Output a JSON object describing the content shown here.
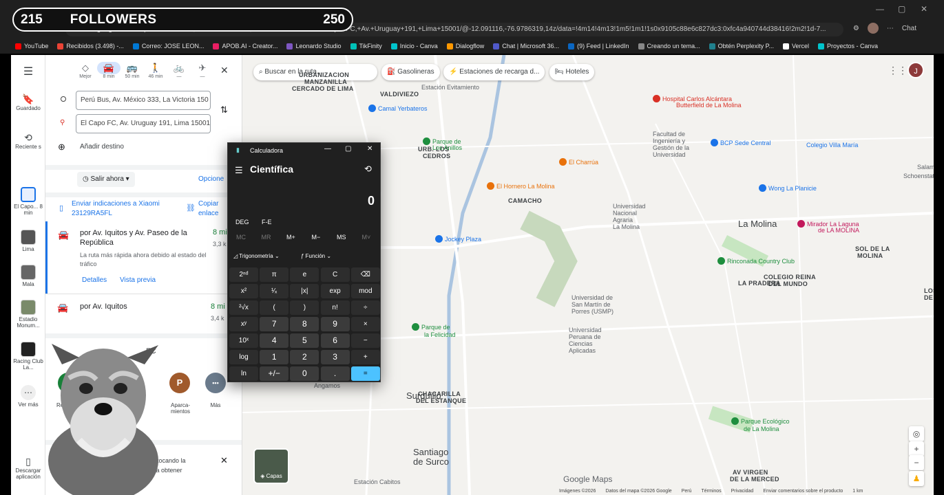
{
  "overlay": {
    "followers_count": "215",
    "followers_label": "FOLLOWERS",
    "followers_goal": "250"
  },
  "browser": {
    "url": "...//www.google.com/maps/dir/Perú+Bus,+Av.+México+333,+La+Victoria+15033/El+Capo+FC,+Av.+Uruguay+191,+Lima+15001/@-12.091116,-76.9786319,14z/data=!4m14!4m13!1m5!1m1!1s0x9105c88e6c827dc3:0xfc4a940744d38416!2m2!1d-7...",
    "chat_label": "Chat",
    "bookmarks": [
      {
        "label": "YouTube",
        "color": "#ff0000"
      },
      {
        "label": "Recibidos (3.498) -...",
        "color": "#ea4335"
      },
      {
        "label": "Correo: JOSE LEON...",
        "color": "#0078d4"
      },
      {
        "label": "APOB.AI - Creator...",
        "color": "#e91e63"
      },
      {
        "label": "Leonardo Studio",
        "color": "#7e57c2"
      },
      {
        "label": "TikFinity",
        "color": "#00c2b8"
      },
      {
        "label": "Inicio - Canva",
        "color": "#00c4cc"
      },
      {
        "label": "Dialogflow",
        "color": "#ff9800"
      },
      {
        "label": "Chat | Microsoft 36...",
        "color": "#5059c9"
      },
      {
        "label": "(9) Feed | LinkedIn",
        "color": "#0a66c2"
      },
      {
        "label": "Creando un tema...",
        "color": "#888888"
      },
      {
        "label": "Obtén Perplexity P...",
        "color": "#20808d"
      },
      {
        "label": "Vercel",
        "color": "#ffffff"
      },
      {
        "label": "Proyectos - Canva",
        "color": "#00c4cc"
      }
    ]
  },
  "rail": {
    "saved": "Guardado",
    "recent": "Reciente s",
    "items": [
      {
        "label": "El Capo... 8 min"
      },
      {
        "label": "Lima"
      },
      {
        "label": "Mala"
      },
      {
        "label": "Estadio Monum..."
      },
      {
        "label": "Racing Club La..."
      }
    ],
    "more": "Ver más",
    "download": "Descargar aplicación"
  },
  "directions": {
    "modes": [
      {
        "icon": "◇",
        "label": "Mejor"
      },
      {
        "icon": "🚘",
        "label": "8 min"
      },
      {
        "icon": "🚌",
        "label": "50 min"
      },
      {
        "icon": "🚶",
        "label": "46 min"
      },
      {
        "icon": "🚲",
        "label": "—"
      },
      {
        "icon": "✈",
        "label": "—"
      }
    ],
    "origin": "Perú Bus, Av. México 333, La Victoria 150",
    "destination": "El Capo FC, Av. Uruguay 191, Lima 15001",
    "add_destination": "Añadir destino",
    "depart": "Salir ahora",
    "options": "Opcione",
    "send_to_phone": "Enviar indicaciones a Xiaomi 23129RA5FL",
    "copy_link": "Copiar enlace",
    "routes": [
      {
        "title": "por Av. Iquitos y Av. Paseo de la República",
        "time": "8 mi",
        "distance": "3,3 k",
        "note": "La ruta más rápida ahora debido al estado del tráfico",
        "details": "Detalles",
        "preview": "Vista previa"
      },
      {
        "title": "por Av. Iquitos",
        "time": "8 mi",
        "distance": "3,4 k"
      }
    ],
    "bottom_label": "FC",
    "actions": [
      {
        "letter": "P",
        "label": "Aparca-mientos"
      },
      {
        "letter": "•••",
        "label": "Más"
      }
    ],
    "partial_action": "Rest",
    "phone_tip": "rayecto tocando la ono para obtener"
  },
  "map": {
    "search_placeholder": "Buscar en la ruta...",
    "chips": [
      "Gasolineras",
      "Estaciones de recarga d...",
      "Hoteles"
    ],
    "layers": "Capas",
    "brand": "Google Maps",
    "labels": [
      {
        "text": "URBANIZACION",
        "cls": "b"
      },
      {
        "text": "MANZANILLA",
        "cls": "b"
      },
      {
        "text": "CERCADO DE LIMA",
        "cls": "b"
      },
      {
        "text": "VALDIVIEZO",
        "cls": "b"
      },
      {
        "text": "Estación Evitamiento",
        "cls": ""
      },
      {
        "text": "URB. LOS",
        "cls": "b"
      },
      {
        "text": "CEDROS",
        "cls": "b"
      },
      {
        "text": "CAMACHO",
        "cls": "b"
      },
      {
        "text": "La Molina",
        "cls": "big"
      },
      {
        "text": "LA PRADERA",
        "cls": "b"
      },
      {
        "text": "COLEGIO REINA",
        "cls": "b"
      },
      {
        "text": "DEL MUNDO",
        "cls": "b"
      },
      {
        "text": "SOL DE LA",
        "cls": "b"
      },
      {
        "text": "MOLINA",
        "cls": "b"
      },
      {
        "text": "LOS HUERTO",
        "cls": "b"
      },
      {
        "text": "DE LA MOLI",
        "cls": "b"
      },
      {
        "text": "Salam",
        "cls": ""
      },
      {
        "text": "Schoenstatt",
        "cls": ""
      },
      {
        "text": "Universidad de",
        "cls": ""
      },
      {
        "text": "San Martín de",
        "cls": ""
      },
      {
        "text": "Porres (USMP)",
        "cls": ""
      },
      {
        "text": "Universidad",
        "cls": ""
      },
      {
        "text": "Peruana de",
        "cls": ""
      },
      {
        "text": "Ciencias",
        "cls": ""
      },
      {
        "text": "Aplicadas",
        "cls": ""
      },
      {
        "text": "Universidad",
        "cls": ""
      },
      {
        "text": "Nacional",
        "cls": ""
      },
      {
        "text": "Agraria",
        "cls": ""
      },
      {
        "text": "La Molina",
        "cls": ""
      },
      {
        "text": "Facultad de",
        "cls": ""
      },
      {
        "text": "Ingeniería y",
        "cls": ""
      },
      {
        "text": "Gestión de la",
        "cls": ""
      },
      {
        "text": "Universidad",
        "cls": ""
      },
      {
        "text": "Surquillo",
        "cls": "big"
      },
      {
        "text": "CHACARILLA",
        "cls": "b"
      },
      {
        "text": "DEL ESTANQUE",
        "cls": "b"
      },
      {
        "text": "Santiago",
        "cls": "big"
      },
      {
        "text": "de Surco",
        "cls": "big"
      },
      {
        "text": "Angamos",
        "cls": ""
      },
      {
        "text": "Estación Cabitos",
        "cls": ""
      },
      {
        "text": "AV VIRGEN",
        "cls": "b"
      },
      {
        "text": "DE LA MERCED",
        "cls": "b"
      }
    ],
    "pins": [
      {
        "text": "Camal Yerbateros",
        "color": "#1a73e8"
      },
      {
        "text": "Hospital Carlos Alcántara",
        "color": "#d93025"
      },
      {
        "text": "Butterfield de La Molina",
        "color": ""
      },
      {
        "text": "BCP Sede Central",
        "color": "#1a73e8"
      },
      {
        "text": "Colegio Villa María",
        "color": ""
      },
      {
        "text": "Parque de",
        "color": "#1e8e3e"
      },
      {
        "text": "Los Anillos",
        "color": ""
      },
      {
        "text": "El Charrúa",
        "color": "#e8710a"
      },
      {
        "text": "El Hornero La Molina",
        "color": "#e8710a"
      },
      {
        "text": "Wong La Planicie",
        "color": "#1a73e8"
      },
      {
        "text": "Mirador La Laguna",
        "color": "#c2185b"
      },
      {
        "text": "de LA MOLINA",
        "color": ""
      },
      {
        "text": "Jockey Plaza",
        "color": "#1a73e8"
      },
      {
        "text": "Rinconada Country Club",
        "color": "#1e8e3e"
      },
      {
        "text": "Parque de",
        "color": "#1e8e3e"
      },
      {
        "text": "la Felicidad",
        "color": ""
      },
      {
        "text": "Parque Ecológico",
        "color": "#1e8e3e"
      },
      {
        "text": "de La Molina",
        "color": ""
      }
    ],
    "footer": [
      "Imágenes ©2026",
      "Datos del mapa ©2026 Google",
      "Perú",
      "Términos",
      "Privacidad",
      "Enviar comentarios sobre el producto",
      "1 km"
    ]
  },
  "calculator": {
    "title": "Calculadora",
    "mode": "Científica",
    "display": "0",
    "angle": "DEG",
    "fe": "F-E",
    "memory": [
      "MC",
      "MR",
      "M+",
      "M−",
      "MS",
      "M˅"
    ],
    "trig": "Trigonometría",
    "func": "Función",
    "keys": [
      [
        "2ⁿᵈ",
        "π",
        "e",
        "C",
        "⌫"
      ],
      [
        "x²",
        "¹⁄ₓ",
        "|x|",
        "exp",
        "mod"
      ],
      [
        "²√x",
        "(",
        ")",
        "n!",
        "÷"
      ],
      [
        "xʸ",
        "7",
        "8",
        "9",
        "×"
      ],
      [
        "10ˣ",
        "4",
        "5",
        "6",
        "−"
      ],
      [
        "log",
        "1",
        "2",
        "3",
        "+"
      ],
      [
        "ln",
        "+/−",
        "0",
        ".",
        "="
      ]
    ]
  }
}
